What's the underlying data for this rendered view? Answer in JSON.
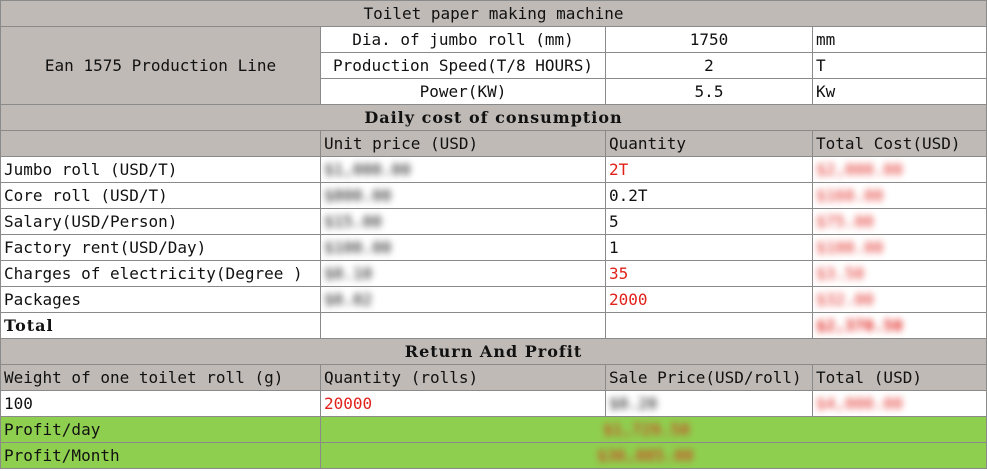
{
  "title": "Toilet paper making machine",
  "production_line": {
    "name": "Ean 1575 Production Line",
    "rows": [
      {
        "label": "Dia. of jumbo roll (mm)",
        "value": "1750",
        "unit": "mm"
      },
      {
        "label": "Production Speed(T/8 HOURS)",
        "value": "2",
        "unit": "T"
      },
      {
        "label": "Power(KW)",
        "value": "5.5",
        "unit": "Kw"
      }
    ]
  },
  "daily_cost": {
    "heading": "Daily cost of consumption",
    "headers": [
      "",
      "Unit price (USD)",
      "Quantity",
      "Total Cost(USD)"
    ],
    "rows": [
      {
        "item": "Jumbo roll (USD/T)",
        "unit_price": "$1,000.00",
        "quantity": "2T",
        "total": "$2,000.00"
      },
      {
        "item": "Core roll (USD/T)",
        "unit_price": "$800.00",
        "quantity": "0.2T",
        "total": "$160.00"
      },
      {
        "item": "Salary(USD/Person)",
        "unit_price": "$15.00",
        "quantity": "5",
        "total": "$75.00"
      },
      {
        "item": "Factory rent(USD/Day)",
        "unit_price": "$100.00",
        "quantity": "1",
        "total": "$100.00"
      },
      {
        "item": "Charges of electricity(Degree )",
        "unit_price": "$0.10",
        "quantity": "35",
        "total": "$3.50"
      },
      {
        "item": "Packages",
        "unit_price": "$0.02",
        "quantity": "2000",
        "total": "$32.00"
      }
    ],
    "total_label": "Total",
    "total_value": "$2,370.50"
  },
  "return_profit": {
    "heading": "Return And Profit",
    "headers": [
      "Weight of one toilet roll (g)",
      "Quantity (rolls)",
      "Sale Price(USD/roll)",
      "Total (USD)"
    ],
    "row": {
      "weight": "100",
      "quantity": "20000",
      "sale_price": "$0.20",
      "total": "$4,000.00"
    },
    "profit_day_label": "Profit/day",
    "profit_day_value": "$1,729.50",
    "profit_month_label": "Profit/Month",
    "profit_month_value": "$36,885.00"
  }
}
